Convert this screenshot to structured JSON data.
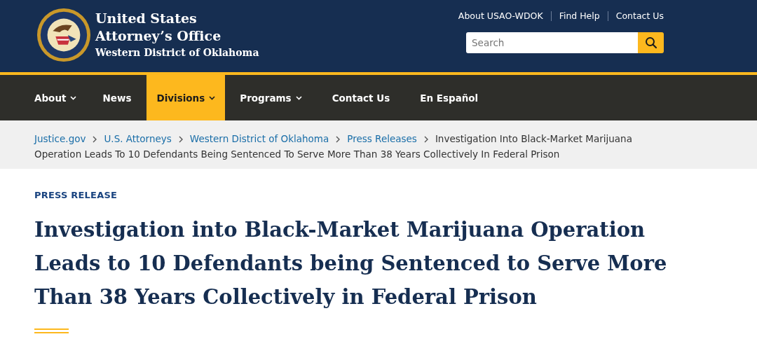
{
  "header": {
    "agency_name": [
      "United States",
      "Attorney’s Office"
    ],
    "district": "Western District of Oklahoma",
    "utility_links": [
      "About USAO-WDOK",
      "Find Help",
      "Contact Us"
    ],
    "search": {
      "placeholder": "Search"
    }
  },
  "nav": [
    {
      "label": "About",
      "dropdown": true,
      "selected": false
    },
    {
      "label": "News",
      "dropdown": false,
      "selected": false
    },
    {
      "label": "Divisions",
      "dropdown": true,
      "selected": true
    },
    {
      "label": "Programs",
      "dropdown": true,
      "selected": false
    },
    {
      "label": "Contact Us",
      "dropdown": false,
      "selected": false
    },
    {
      "label": "En Español",
      "dropdown": false,
      "selected": false
    }
  ],
  "breadcrumb": {
    "links": [
      "Justice.gov",
      "U.S. Attorneys",
      "Western District of Oklahoma",
      "Press Releases"
    ],
    "current": [
      "Investigation Into Black-Market Marijuana",
      "Operation Leads To 10 Defendants Being Sentenced To Serve More Than 38 Years Collectively In Federal Prison"
    ]
  },
  "article": {
    "label": "PRESS RELEASE",
    "title": "Investigation into Black-Market Marijuana Operation Leads to 10 Defendants being Sentenced to Serve More Than 38 Years Collectively in Federal Prison"
  }
}
